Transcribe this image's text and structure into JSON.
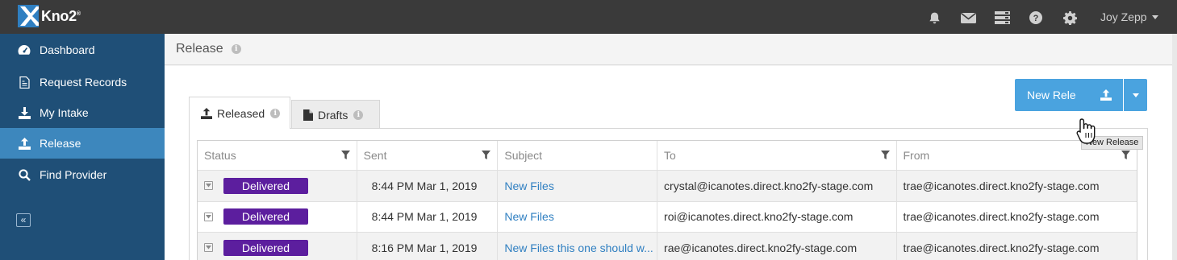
{
  "app": {
    "logo_text": "Kno2",
    "trademark": "®"
  },
  "topbar": {
    "icons": [
      "bell-icon",
      "envelope-icon",
      "server-icon",
      "help-icon",
      "gear-icon"
    ],
    "user_name": "Joy Zepp"
  },
  "sidebar": {
    "items": [
      {
        "label": "Dashboard",
        "icon": "dashboard-icon",
        "active": false
      },
      {
        "label": "Request Records",
        "icon": "document-icon",
        "active": false
      },
      {
        "label": "My Intake",
        "icon": "download-icon",
        "active": false
      },
      {
        "label": "Release",
        "icon": "upload-icon",
        "active": true
      },
      {
        "label": "Find Provider",
        "icon": "search-icon",
        "active": false
      }
    ],
    "collapse_glyph": "«"
  },
  "header": {
    "title": "Release"
  },
  "tabs": [
    {
      "label": "Released",
      "icon": "upload-icon",
      "active": true
    },
    {
      "label": "Drafts",
      "icon": "file-icon",
      "active": false
    }
  ],
  "actions": {
    "new_release_label": "New Rele",
    "tooltip": "New Release"
  },
  "table": {
    "columns": [
      "Status",
      "Sent",
      "Subject",
      "To",
      "From"
    ],
    "rows": [
      {
        "status": "Delivered",
        "sent": "8:44 PM Mar 1, 2019",
        "subject": "New Files",
        "to": "crystal@icanotes.direct.kno2fy-stage.com",
        "from": "trae@icanotes.direct.kno2fy-stage.com"
      },
      {
        "status": "Delivered",
        "sent": "8:44 PM Mar 1, 2019",
        "subject": "New Files",
        "to": "roi@icanotes.direct.kno2fy-stage.com",
        "from": "trae@icanotes.direct.kno2fy-stage.com"
      },
      {
        "status": "Delivered",
        "sent": "8:16 PM Mar 1, 2019",
        "subject": "New Files this one should w...",
        "to": "rae@icanotes.direct.kno2fy-stage.com",
        "from": "trae@icanotes.direct.kno2fy-stage.com"
      }
    ]
  },
  "colors": {
    "sidebar_bg": "#1f4f77",
    "sidebar_active": "#3d87bd",
    "topbar_bg": "#3a3a3a",
    "badge_delivered": "#5c1e9e",
    "primary_button": "#4aa3df",
    "link": "#2f7fc1"
  }
}
